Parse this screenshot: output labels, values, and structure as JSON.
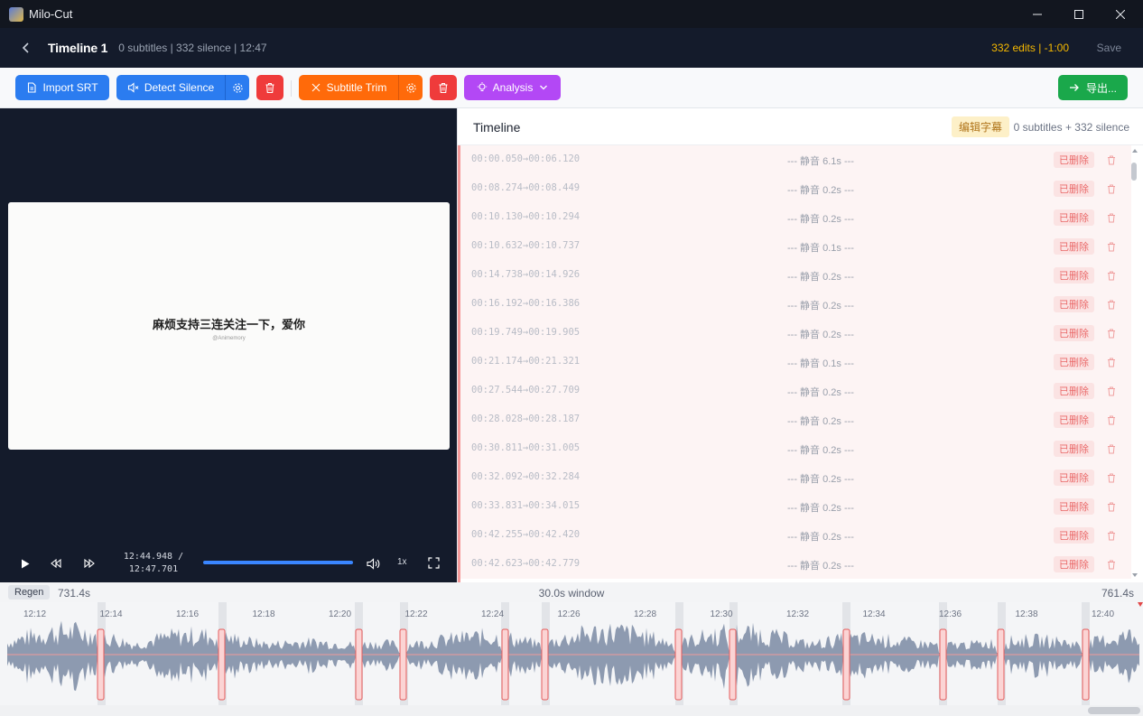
{
  "window": {
    "title": "Milo-Cut"
  },
  "header": {
    "title": "Timeline 1",
    "meta": "0 subtitles | 332 silence | 12:47",
    "edits": "332 edits | -1:00",
    "save_label": "Save"
  },
  "toolbar": {
    "import_label": "Import SRT",
    "detect_label": "Detect Silence",
    "subtitle_trim_label": "Subtitle Trim",
    "analysis_label": "Analysis",
    "export_label": "导出..."
  },
  "player": {
    "caption": "麻烦支持三连关注一下，爱你",
    "watermark": "@Animemory",
    "current_time": "12:44.948 /",
    "total_time": "12:47.701",
    "speed": "1x",
    "progress": 0.9978
  },
  "timeline": {
    "title": "Timeline",
    "edit_label": "编辑字幕",
    "summary": "0 subtitles + 332 silence",
    "rows": [
      {
        "time": "00:00.050→00:06.120",
        "label": "--- 静音 6.1s ---",
        "status": "已删除"
      },
      {
        "time": "00:08.274→00:08.449",
        "label": "--- 静音 0.2s ---",
        "status": "已删除"
      },
      {
        "time": "00:10.130→00:10.294",
        "label": "--- 静音 0.2s ---",
        "status": "已删除"
      },
      {
        "time": "00:10.632→00:10.737",
        "label": "--- 静音 0.1s ---",
        "status": "已删除"
      },
      {
        "time": "00:14.738→00:14.926",
        "label": "--- 静音 0.2s ---",
        "status": "已删除"
      },
      {
        "time": "00:16.192→00:16.386",
        "label": "--- 静音 0.2s ---",
        "status": "已删除"
      },
      {
        "time": "00:19.749→00:19.905",
        "label": "--- 静音 0.2s ---",
        "status": "已删除"
      },
      {
        "time": "00:21.174→00:21.321",
        "label": "--- 静音 0.1s ---",
        "status": "已删除"
      },
      {
        "time": "00:27.544→00:27.709",
        "label": "--- 静音 0.2s ---",
        "status": "已删除"
      },
      {
        "time": "00:28.028→00:28.187",
        "label": "--- 静音 0.2s ---",
        "status": "已删除"
      },
      {
        "time": "00:30.811→00:31.005",
        "label": "--- 静音 0.2s ---",
        "status": "已删除"
      },
      {
        "time": "00:32.092→00:32.284",
        "label": "--- 静音 0.2s ---",
        "status": "已删除"
      },
      {
        "time": "00:33.831→00:34.015",
        "label": "--- 静音 0.2s ---",
        "status": "已删除"
      },
      {
        "time": "00:42.255→00:42.420",
        "label": "--- 静音 0.2s ---",
        "status": "已删除"
      },
      {
        "time": "00:42.623→00:42.779",
        "label": "--- 静音 0.2s ---",
        "status": "已删除"
      }
    ]
  },
  "waveform": {
    "regen_label": "Regen",
    "start_label": "731.4s",
    "window_label": "30.0s window",
    "end_label": "761.4s",
    "ticks": [
      "12:12",
      "12:14",
      "12:16",
      "12:18",
      "12:20",
      "12:22",
      "12:24",
      "12:26",
      "12:28",
      "12:30",
      "12:32",
      "12:34",
      "12:36",
      "12:38",
      "12:40"
    ]
  },
  "colors": {
    "accent_blue": "#2b7cf0",
    "orange": "#ff6a0a",
    "red": "#ef3b3b",
    "purple": "#b348f5",
    "green": "#1aa84b",
    "edits_yellow": "#f5b800"
  }
}
